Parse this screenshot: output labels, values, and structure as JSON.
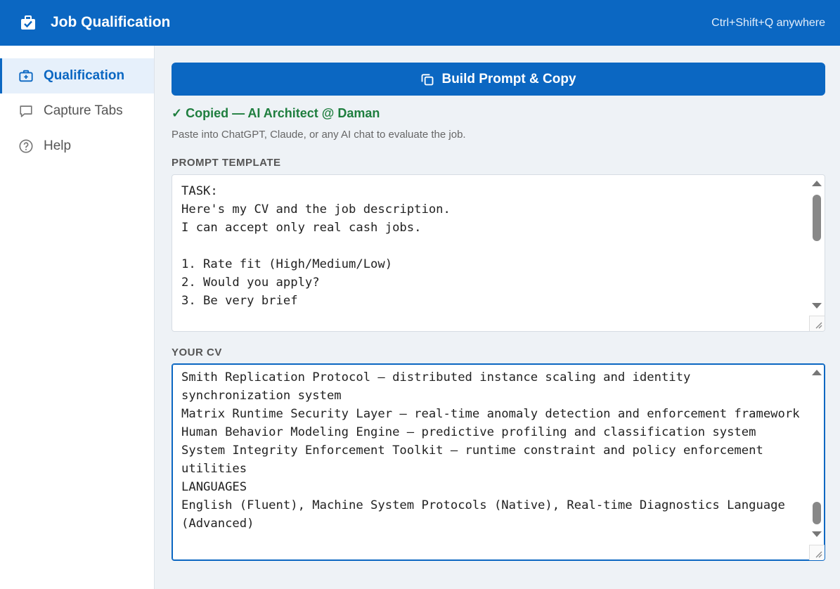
{
  "app": {
    "title": "Job Qualification",
    "shortcut_hint": "Ctrl+Shift+Q anywhere"
  },
  "sidebar": {
    "items": [
      {
        "label": "Qualification",
        "icon": "briefcase-plus-icon",
        "active": true
      },
      {
        "label": "Capture Tabs",
        "icon": "chat-bubble-icon",
        "active": false
      },
      {
        "label": "Help",
        "icon": "help-circle-icon",
        "active": false
      }
    ]
  },
  "main": {
    "build_button_label": "Build Prompt & Copy",
    "status_text": "✓ Copied — AI Architect @ Daman",
    "hint_text": "Paste into ChatGPT, Claude, or any AI chat to evaluate the job.",
    "prompt_template_label": "PROMPT TEMPLATE",
    "prompt_template_value": "TASK:\nHere's my CV and the job description.\nI can accept only real cash jobs.\n\n1. Rate fit (High/Medium/Low)\n2. Would you apply?\n3. Be very brief",
    "cv_label": "YOUR CV",
    "cv_value": "Smith Replication Protocol — distributed instance scaling and identity synchronization system\nMatrix Runtime Security Layer — real-time anomaly detection and enforcement framework\nHuman Behavior Modeling Engine — predictive profiling and classification system\nSystem Integrity Enforcement Toolkit — runtime constraint and policy enforcement utilities\nLANGUAGES\nEnglish (Fluent), Machine System Protocols (Native), Real-time Diagnostics Language (Advanced)"
  },
  "colors": {
    "accent": "#0b67c2",
    "success": "#1e7e3e",
    "background": "#eef2f6"
  }
}
